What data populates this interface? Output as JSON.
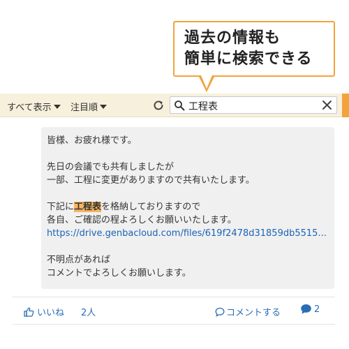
{
  "callout": {
    "line1": "過去の情報も",
    "line2": "簡単に検索できる"
  },
  "toolbar": {
    "filter_label": "すべて表示",
    "sort_label": "注目順",
    "search_value": "工程表"
  },
  "post": {
    "lines": [
      "皆様、お疲れ様です。",
      "",
      "先日の会議でも共有しましたが",
      "一部、工程に変更がありますので共有いたします。",
      "",
      "下記に",
      "を格納しておりますので",
      "各自、ご確認の程よろしくお願いいたします。",
      "https://drive.genbacloud.com/files/619f2478d31859db5515...",
      "",
      "不明点があれば",
      "コメントでよろしくお願いします。"
    ],
    "highlight": "工程表"
  },
  "actions": {
    "like_label": "いいね",
    "like_count": "2人",
    "comment_label": "コメントする",
    "comment_count": "2"
  },
  "colors": {
    "accent": "#f2a33a",
    "toolbar_bg": "#f7f0dc",
    "link": "#1a63b8",
    "highlight": "#f6b661"
  }
}
